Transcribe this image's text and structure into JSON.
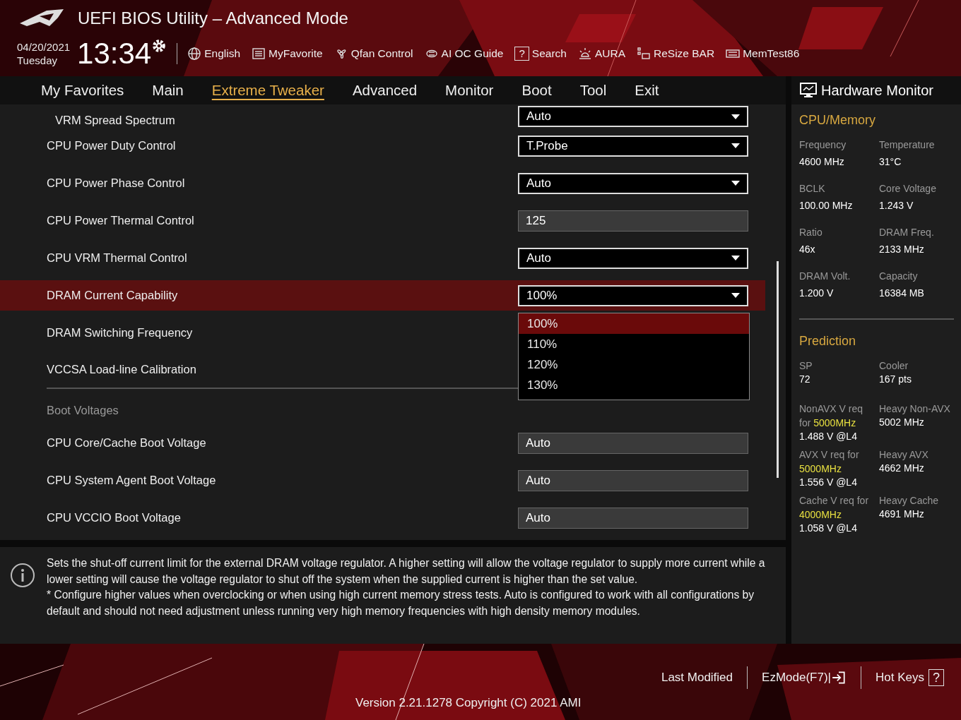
{
  "header": {
    "title": "UEFI BIOS Utility – Advanced Mode",
    "date": "04/20/2021",
    "day": "Tuesday",
    "time": "13:34",
    "toolbar": [
      {
        "label": "English"
      },
      {
        "label": "MyFavorite"
      },
      {
        "label": "Qfan Control"
      },
      {
        "label": "AI OC Guide"
      },
      {
        "label": "Search",
        "glyph": "?"
      },
      {
        "label": "AURA"
      },
      {
        "label": "ReSize BAR"
      },
      {
        "label": "MemTest86"
      }
    ]
  },
  "tabs": [
    {
      "label": "My Favorites",
      "selected": false
    },
    {
      "label": "Main",
      "selected": false
    },
    {
      "label": "Extreme Tweaker",
      "selected": true
    },
    {
      "label": "Advanced",
      "selected": false
    },
    {
      "label": "Monitor",
      "selected": false
    },
    {
      "label": "Boot",
      "selected": false
    },
    {
      "label": "Tool",
      "selected": false
    },
    {
      "label": "Exit",
      "selected": false
    }
  ],
  "settings": [
    {
      "kind": "dropdown",
      "label": "VRM Spread Spectrum",
      "value": "Auto",
      "selected": false
    },
    {
      "kind": "dropdown",
      "label": "CPU Power Duty Control",
      "value": "T.Probe",
      "selected": false
    },
    {
      "kind": "dropdown",
      "label": "CPU Power Phase Control",
      "value": "Auto",
      "selected": false
    },
    {
      "kind": "field",
      "label": "CPU Power Thermal Control",
      "value": "125",
      "selected": false
    },
    {
      "kind": "dropdown",
      "label": "CPU VRM Thermal Control",
      "value": "Auto",
      "selected": false
    },
    {
      "kind": "dropdown",
      "label": "DRAM Current Capability",
      "value": "100%",
      "selected": true,
      "options": [
        {
          "label": "100%",
          "selected": true
        },
        {
          "label": "110%",
          "selected": false
        },
        {
          "label": "120%",
          "selected": false
        },
        {
          "label": "130%",
          "selected": false
        }
      ]
    },
    {
      "kind": "plain",
      "label": "DRAM Switching Frequency",
      "selected": false
    },
    {
      "kind": "plain",
      "label": "VCCSA Load-line Calibration",
      "selected": false
    },
    {
      "kind": "header",
      "label": "Boot Voltages"
    },
    {
      "kind": "field",
      "label": "CPU Core/Cache Boot Voltage",
      "value": "Auto",
      "selected": false
    },
    {
      "kind": "field",
      "label": "CPU System Agent Boot Voltage",
      "value": "Auto",
      "selected": false
    },
    {
      "kind": "field",
      "label": "CPU VCCIO Boot Voltage",
      "value": "Auto",
      "selected": false
    }
  ],
  "help": [
    "Sets the shut-off current limit for the external DRAM voltage regulator. A higher setting will allow the voltage regulator to supply more current while a lower setting will cause the voltage regulator to shut off the system when the supplied current is higher than the set value.",
    "* Configure higher values when overclocking or when using high current memory stress tests. Auto is configured to work with all configurations by default and should not need adjustment unless running very high memory frequencies with high density memory modules."
  ],
  "hardware_monitor": {
    "title": "Hardware Monitor",
    "sections": [
      {
        "title": "CPU/Memory",
        "items": [
          {
            "label": "Frequency",
            "value": "4600 MHz"
          },
          {
            "label": "Temperature",
            "value": "31°C"
          },
          {
            "label": "BCLK",
            "value": "100.00 MHz"
          },
          {
            "label": "Core Voltage",
            "value": "1.243 V"
          },
          {
            "label": "Ratio",
            "value": "46x"
          },
          {
            "label": "DRAM Freq.",
            "value": "2133 MHz"
          },
          {
            "label": "DRAM Volt.",
            "value": "1.200 V"
          },
          {
            "label": "Capacity",
            "value": "16384 MB"
          }
        ]
      },
      {
        "title": "Prediction",
        "items": [
          {
            "label": "SP",
            "value": "72"
          },
          {
            "label": "Cooler",
            "value": "167 pts"
          },
          {
            "label": "NonAVX V req for **5000MHz**",
            "value": "1.488 V @L4"
          },
          {
            "label": "Heavy Non-AVX",
            "value": "5002 MHz"
          },
          {
            "label": "AVX V req for **5000MHz**",
            "value": "1.556 V @L4"
          },
          {
            "label": "Heavy AVX",
            "value": "4662 MHz"
          },
          {
            "label": "Cache V req for **4000MHz**",
            "value": "1.058 V @L4"
          },
          {
            "label": "Heavy Cache",
            "value": "4691 MHz"
          }
        ]
      }
    ]
  },
  "footer": {
    "last_modified": "Last Modified",
    "ezmode": "EzMode(F7)|",
    "hotkeys": "Hot Keys",
    "hotkeys_glyph": "?",
    "version": "Version 2.21.1278 Copyright (C) 2021 AMI"
  }
}
